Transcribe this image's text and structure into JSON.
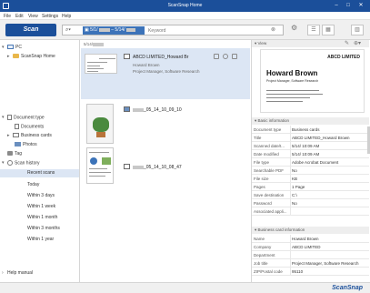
{
  "window": {
    "title": "ScanSnap Home",
    "minimize": "–",
    "maximize": "□",
    "close": "✕"
  },
  "menu": [
    "File",
    "Edit",
    "View",
    "Settings",
    "Help"
  ],
  "toolbar": {
    "scan_label": "Scan",
    "date_from": "5/1/",
    "date_to": "5/14/",
    "search_placeholder": "Keyword"
  },
  "sidebar": {
    "pc_label": "PC",
    "scansnap_home_label": "ScanSnap Home",
    "document_type_label": "Document type",
    "documents_label": "Documents",
    "business_cards_label": "Business cards",
    "photos_label": "Photos",
    "tag_label": "Tag",
    "scan_history_label": "Scan history",
    "history_items": [
      "Recent scans",
      "Today",
      "Within 3 days",
      "Within 1 week",
      "Within 1 month",
      "Within 3 months",
      "Within 1 year"
    ],
    "help_label": "Help manual"
  },
  "list": {
    "date_header": "5/14/",
    "items": [
      {
        "name": "ABCD LIMITED_Howard Br",
        "sub1": "Howard Brown",
        "sub2": "Project Manager, Software Research"
      },
      {
        "name": "_05_14_10_09_10"
      },
      {
        "name": "_05_14_10_08_47"
      }
    ]
  },
  "preview": {
    "header": "View",
    "card_company": "ABCD LIMITED",
    "card_name": "Howard Brown",
    "card_title": "Project Manager, Software Research"
  },
  "basic_info": {
    "header": "Basic information",
    "rows": [
      {
        "k": "Document type",
        "v": "Business cards"
      },
      {
        "k": "Title",
        "v": "ABCD LIMITED_Howard Brown"
      },
      {
        "k": "Scanned date/t...",
        "v": "5/14/          10:09 AM"
      },
      {
        "k": "Date modified",
        "v": "5/14/          10:09 AM"
      },
      {
        "k": "File type",
        "v": "Adobe Acrobat Document"
      },
      {
        "k": "Searchable PDF",
        "v": "No"
      },
      {
        "k": "File size",
        "v": "          KB"
      },
      {
        "k": "Pages",
        "v": "1 Page"
      },
      {
        "k": "Save destination",
        "v": "C:\\"
      },
      {
        "k": "Password",
        "v": "No"
      },
      {
        "k": "Associated appli...",
        "v": ""
      }
    ]
  },
  "card_info": {
    "header": "Business card information",
    "rows": [
      {
        "k": "Name",
        "v": "Howard Brown"
      },
      {
        "k": "Company",
        "v": "ABCD LIMITED"
      },
      {
        "k": "Department",
        "v": ""
      },
      {
        "k": "Job title",
        "v": "Project Manager, Software Research"
      },
      {
        "k": "ZIP/Postal code",
        "v": "95110"
      }
    ]
  },
  "status": {
    "logo": "ScanSnap"
  }
}
